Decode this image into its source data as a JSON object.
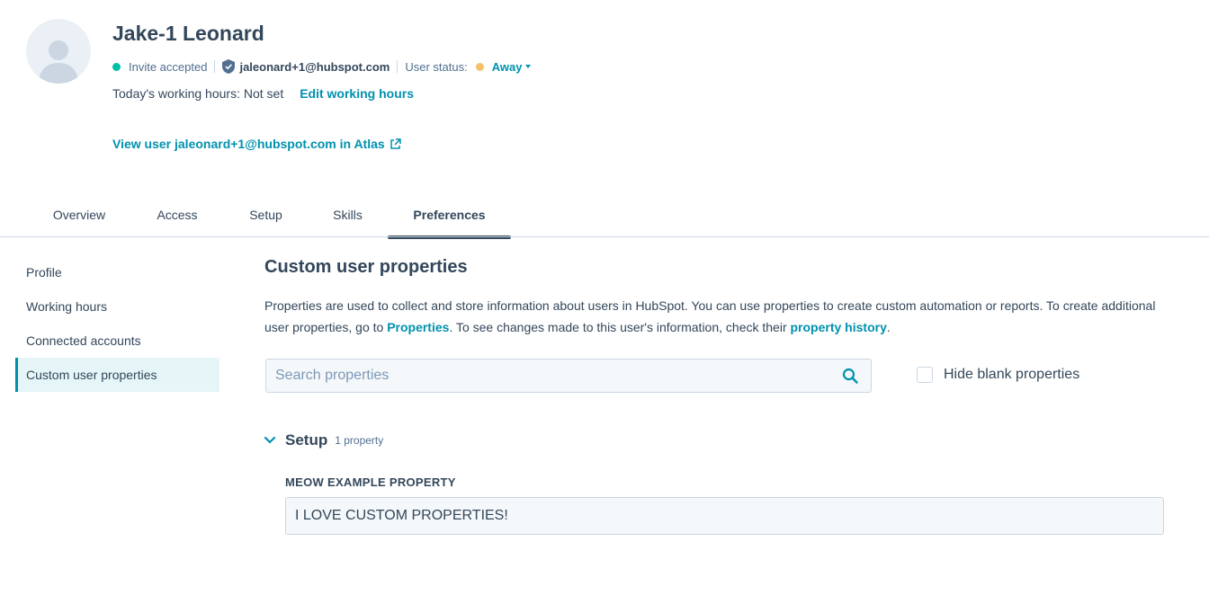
{
  "user": {
    "name": "Jake-1 Leonard",
    "invite_status": "Invite accepted",
    "email": "jaleonard+1@hubspot.com",
    "user_status_label": "User status:",
    "user_status_value": "Away"
  },
  "working_hours": {
    "text": "Today's working hours: Not set",
    "edit_link": "Edit working hours"
  },
  "atlas_link": "View user jaleonard+1@hubspot.com in Atlas",
  "tabs": [
    {
      "label": "Overview",
      "active": false
    },
    {
      "label": "Access",
      "active": false
    },
    {
      "label": "Setup",
      "active": false
    },
    {
      "label": "Skills",
      "active": false
    },
    {
      "label": "Preferences",
      "active": true
    }
  ],
  "sidebar": {
    "items": [
      {
        "label": "Profile",
        "active": false
      },
      {
        "label": "Working hours",
        "active": false
      },
      {
        "label": "Connected accounts",
        "active": false
      },
      {
        "label": "Custom user properties",
        "active": true
      }
    ]
  },
  "main": {
    "title": "Custom user properties",
    "intro_part1": "Properties are used to collect and store information about users in HubSpot. You can use properties to create custom automation or reports. To create additional user properties, go to ",
    "intro_link1": "Properties",
    "intro_part2": ". To see changes made to this user's information, check their ",
    "intro_link2": "property history",
    "intro_part3": ".",
    "search_placeholder": "Search properties",
    "hide_blank_label": "Hide blank properties",
    "group": {
      "title": "Setup",
      "count": "1 property",
      "property_label": "MEOW EXAMPLE PROPERTY",
      "property_value": "I LOVE CUSTOM PROPERTIES!"
    }
  },
  "colors": {
    "link": "#0091ae",
    "text": "#33475b",
    "status_green": "#00bda5",
    "status_yellow": "#f5c26b",
    "active_bg": "#e5f5f8"
  },
  "icons": [
    "avatar-placeholder-icon",
    "shield-check-icon",
    "external-link-icon",
    "search-icon",
    "chevron-down-icon",
    "caret-down-icon"
  ]
}
